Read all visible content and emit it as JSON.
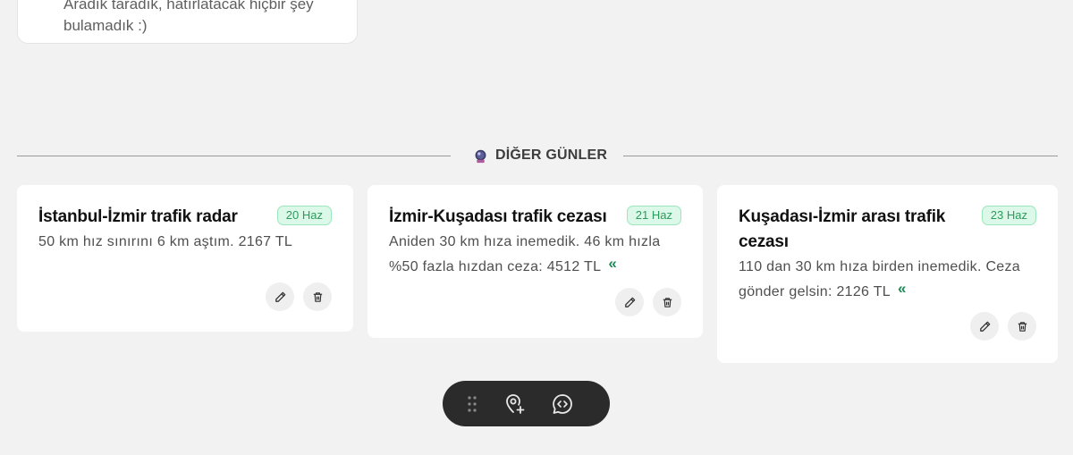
{
  "top_card": {
    "text": "Aradık taradık, hatırlatacak hiçbir şey bulamadık :)"
  },
  "section": {
    "title": "DİĞER GÜNLER"
  },
  "cards": [
    {
      "title": "İstanbul-İzmir trafik radar",
      "date": "20 Haz",
      "body": "50 km hız sınırını 6 km aştım. 2167 TL",
      "has_expand": false
    },
    {
      "title": "İzmir-Kuşadası trafik cezası",
      "date": "21 Haz",
      "body": "Aniden 30 km hıza inemedik. 46 km hızla %50 fazla hızdan ceza: 4512 TL",
      "has_expand": true
    },
    {
      "title": "Kuşadası-İzmir arası trafik cezası",
      "date": "23 Haz",
      "body": "110 dan 30 km hıza birden inemedik. Ceza gönder gelsin: 2126 TL",
      "has_expand": true
    }
  ],
  "icons": {
    "edit": "pencil-icon",
    "delete": "trash-icon",
    "expand": "double-chevron-left-icon",
    "drag": "drag-handle-icon",
    "add_location": "map-pin-plus-icon",
    "chat": "chat-code-icon",
    "section": "crystal-ball-icon"
  },
  "colors": {
    "background": "#f2f2f2",
    "card": "#ffffff",
    "badge_bg": "#dcf8e8",
    "badge_text": "#2d9a5e",
    "accent": "#1e8a55",
    "toolbar": "#2b2b2b"
  }
}
